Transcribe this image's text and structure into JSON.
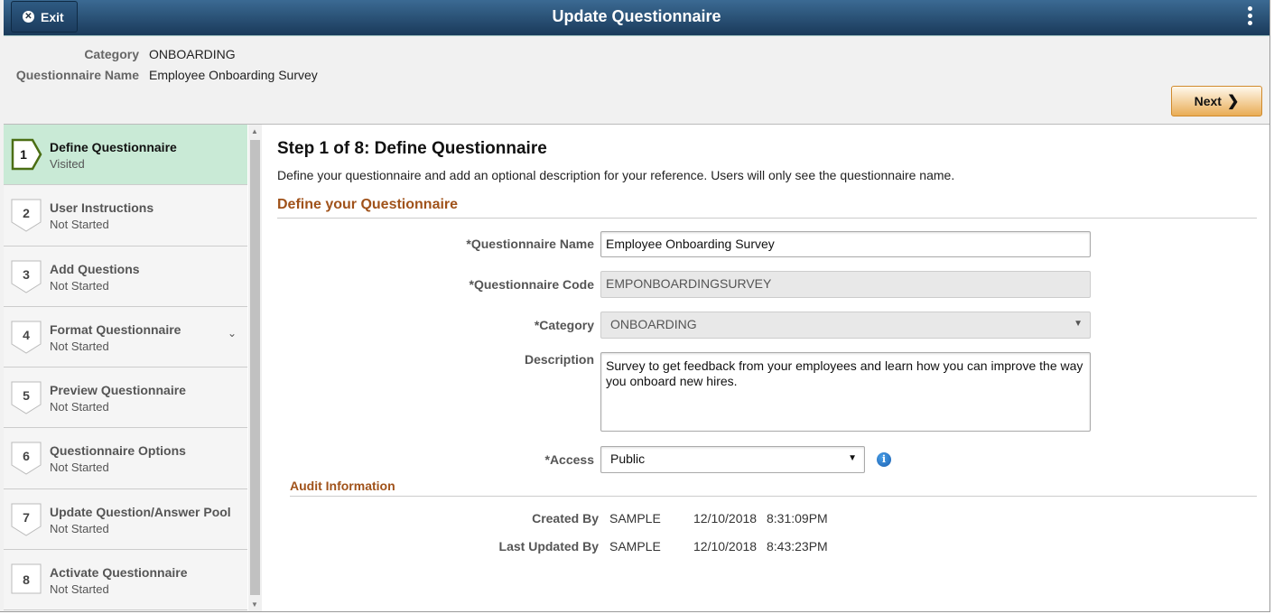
{
  "header": {
    "title": "Update Questionnaire",
    "exit_label": "Exit",
    "exit_icon": "close-icon",
    "menu_icon": "more-vertical-icon"
  },
  "summary": {
    "category_label": "Category",
    "category_value": "ONBOARDING",
    "name_label": "Questionnaire Name",
    "name_value": "Employee Onboarding Survey"
  },
  "next_label": "Next",
  "steps": [
    {
      "num": "1",
      "title": "Define Questionnaire",
      "status": "Visited"
    },
    {
      "num": "2",
      "title": "User Instructions",
      "status": "Not Started"
    },
    {
      "num": "3",
      "title": "Add Questions",
      "status": "Not Started"
    },
    {
      "num": "4",
      "title": "Format Questionnaire",
      "status": "Not Started"
    },
    {
      "num": "5",
      "title": "Preview Questionnaire",
      "status": "Not Started"
    },
    {
      "num": "6",
      "title": "Questionnaire Options",
      "status": "Not Started"
    },
    {
      "num": "7",
      "title": "Update Question/Answer Pool",
      "status": "Not Started"
    },
    {
      "num": "8",
      "title": "Activate Questionnaire",
      "status": "Not Started"
    }
  ],
  "main": {
    "heading": "Step 1 of 8: Define Questionnaire",
    "intro": "Define your questionnaire and add an optional description for your reference. Users will only see the questionnaire name.",
    "section": "Define your Questionnaire",
    "fields": {
      "name_label": "*Questionnaire Name",
      "name_value": "Employee Onboarding Survey",
      "code_label": "*Questionnaire Code",
      "code_value": "EMPONBOARDINGSURVEY",
      "category_label": "*Category",
      "category_value": "ONBOARDING",
      "description_label": "Description",
      "description_value": "Survey to get feedback from your employees and learn how you can improve the way you onboard new hires.",
      "access_label": "*Access",
      "access_value": "Public"
    },
    "audit": {
      "title": "Audit Information",
      "created_label": "Created By",
      "created_by": "SAMPLE",
      "created_date": "12/10/2018",
      "created_time": "8:31:09PM",
      "updated_label": "Last Updated By",
      "updated_by": "SAMPLE",
      "updated_date": "12/10/2018",
      "updated_time": "8:43:23PM"
    }
  },
  "colors": {
    "header": "#1f4266",
    "active_step": "#c9ead6",
    "section": "#a0521a",
    "next_button": "#e9ac55"
  }
}
